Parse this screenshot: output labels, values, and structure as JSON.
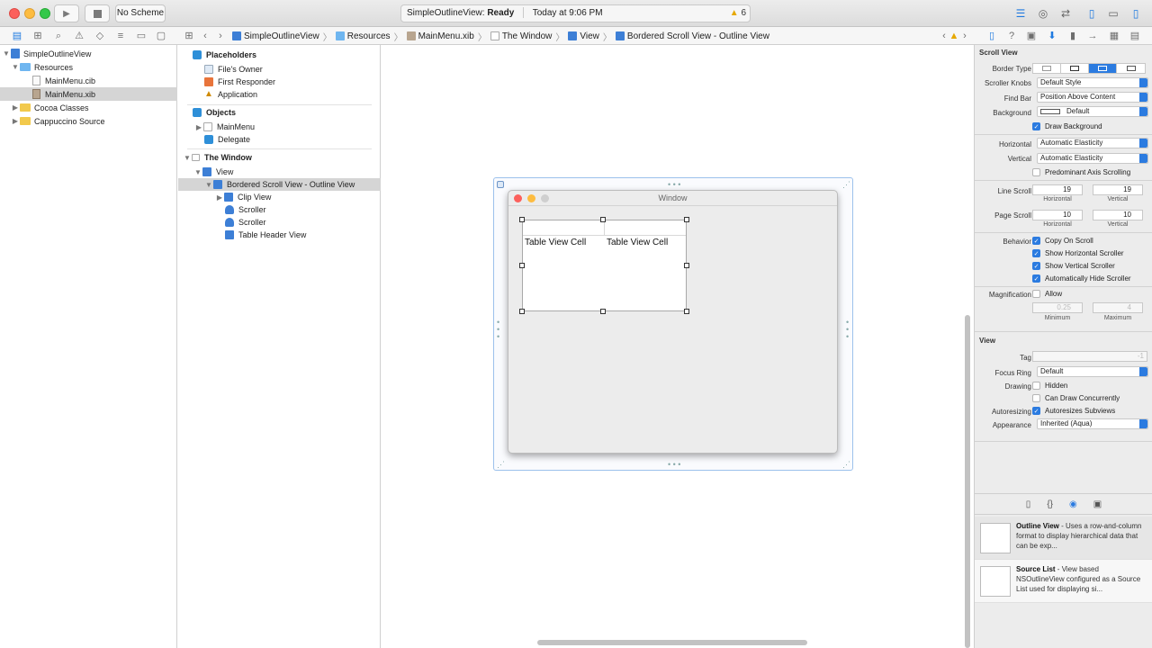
{
  "toolbar": {
    "scheme": "No Scheme",
    "activity_project": "SimpleOutlineView:",
    "activity_status": "Ready",
    "activity_time": "Today at 9:06 PM",
    "warning_count": "6"
  },
  "breadcrumb": [
    "SimpleOutlineView",
    "Resources",
    "MainMenu.xib",
    "The Window",
    "View",
    "Bordered Scroll View - Outline View"
  ],
  "navigator": {
    "items": [
      {
        "label": "SimpleOutlineView"
      },
      {
        "label": "Resources"
      },
      {
        "label": "MainMenu.cib"
      },
      {
        "label": "MainMenu.xib"
      },
      {
        "label": "Cocoa Classes"
      },
      {
        "label": "Cappuccino Source"
      }
    ]
  },
  "outline": {
    "placeholders_title": "Placeholders",
    "placeholders": [
      "File's Owner",
      "First Responder",
      "Application"
    ],
    "objects_title": "Objects",
    "objects": [
      "MainMenu",
      "Delegate"
    ],
    "window_title": "The Window",
    "window_items": [
      "View",
      "Bordered Scroll View - Outline View",
      "Clip View",
      "Scroller",
      "Scroller",
      "Table Header View"
    ]
  },
  "canvas": {
    "window_title": "Window",
    "cell1": "Table View Cell",
    "cell2": "Table View Cell"
  },
  "inspector": {
    "scroll_view_title": "Scroll View",
    "border_type_label": "Border Type",
    "scroller_knobs_label": "Scroller Knobs",
    "scroller_knobs_value": "Default Style",
    "find_bar_label": "Find Bar",
    "find_bar_value": "Position Above Content",
    "background_label": "Background",
    "background_value": "Default",
    "draw_background": "Draw Background",
    "horizontal_label": "Horizontal",
    "horizontal_value": "Automatic Elasticity",
    "vertical_label": "Vertical",
    "vertical_value": "Automatic Elasticity",
    "predominant_axis": "Predominant Axis Scrolling",
    "line_scroll_label": "Line Scroll",
    "line_scroll_h": "19",
    "line_scroll_v": "19",
    "page_scroll_label": "Page Scroll",
    "page_scroll_h": "10",
    "page_scroll_v": "10",
    "horizontal_sub": "Horizontal",
    "vertical_sub": "Vertical",
    "behavior_label": "Behavior",
    "copy_on_scroll": "Copy On Scroll",
    "show_h_scroller": "Show Horizontal Scroller",
    "show_v_scroller": "Show Vertical Scroller",
    "auto_hide": "Automatically Hide Scroller",
    "magnification_label": "Magnification",
    "allow": "Allow",
    "min_value": "0.25",
    "max_value": "4",
    "minimum": "Minimum",
    "maximum": "Maximum",
    "view_title": "View",
    "tag_label": "Tag",
    "tag_value": "-1",
    "focus_ring_label": "Focus Ring",
    "focus_ring_value": "Default",
    "drawing_label": "Drawing",
    "hidden": "Hidden",
    "can_draw": "Can Draw Concurrently",
    "autoresizing_label": "Autoresizing",
    "autoresizes": "Autoresizes Subviews",
    "appearance_label": "Appearance",
    "appearance_value": "Inherited (Aqua)"
  },
  "library": [
    {
      "title": "Outline View",
      "desc": " - Uses a row-and-column format to display hierarchical data that can be exp..."
    },
    {
      "title": "Source List",
      "desc": " - View based NSOutlineView configured as a Source List used for displaying si..."
    }
  ],
  "colors": {
    "accent": "#2b7be0",
    "selection": "#d5d5d5",
    "close": "#fc605c",
    "minimize": "#fdbc40",
    "zoom": "#34c84a"
  }
}
